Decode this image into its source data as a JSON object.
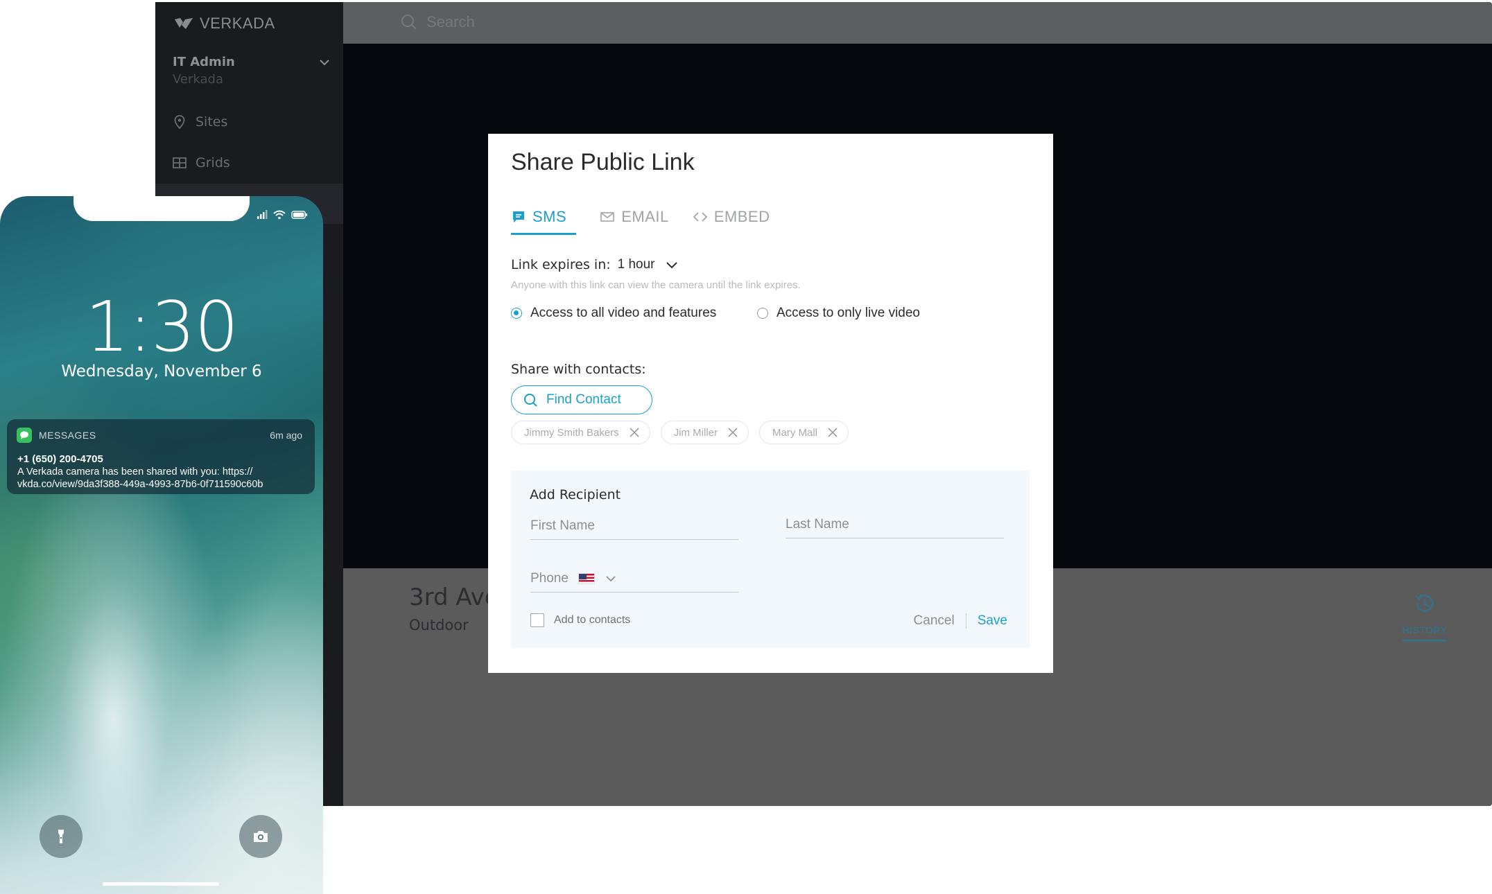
{
  "app": {
    "brand": "VERKADA",
    "user": {
      "name": "IT Admin",
      "org": "Verkada"
    },
    "nav": [
      {
        "label": "Sites",
        "icon": "map-pin-icon"
      },
      {
        "label": "Grids",
        "icon": "grid-icon"
      }
    ],
    "search_placeholder": "Search",
    "camera": {
      "title": "3rd Ave",
      "subtitle": "Outdoor"
    },
    "history_tab": "HISTORY"
  },
  "modal": {
    "title": "Share Public Link",
    "tabs": [
      {
        "label": "SMS",
        "icon": "message-icon",
        "active": true
      },
      {
        "label": "EMAIL",
        "icon": "mail-icon",
        "active": false
      },
      {
        "label": "EMBED",
        "icon": "code-icon",
        "active": false
      }
    ],
    "expires_label": "Link expires in:",
    "expires_value": "1 hour",
    "expires_note": "Anyone with this link can view the camera until the link expires.",
    "access_options": [
      {
        "label": "Access to all video and features",
        "checked": true
      },
      {
        "label": "Access to only live video",
        "checked": false
      }
    ],
    "contacts_label": "Share with contacts:",
    "find_contact": "Find Contact",
    "chips": [
      "Jimmy Smith Bakers",
      "Jim Miller",
      "Mary Mall"
    ],
    "recipient": {
      "title": "Add Recipient",
      "first_name_placeholder": "First Name",
      "last_name_placeholder": "Last Name",
      "phone_label": "Phone",
      "add_to_contacts": "Add to contacts",
      "cancel": "Cancel",
      "save": "Save"
    }
  },
  "phone": {
    "time": "1:30",
    "date": "Wednesday, November 6",
    "notification": {
      "app": "MESSAGES",
      "age": "6m ago",
      "sender": "+1 (650) 200-4705",
      "body": "A Verkada camera has been shared with you: https:// vkda.co/view/9da3f388-449a-4993-87b6-0f711590c60b"
    }
  },
  "colors": {
    "accent": "#1a9ed0",
    "sidebar": "#1a1b1f",
    "video": "#06080d"
  }
}
